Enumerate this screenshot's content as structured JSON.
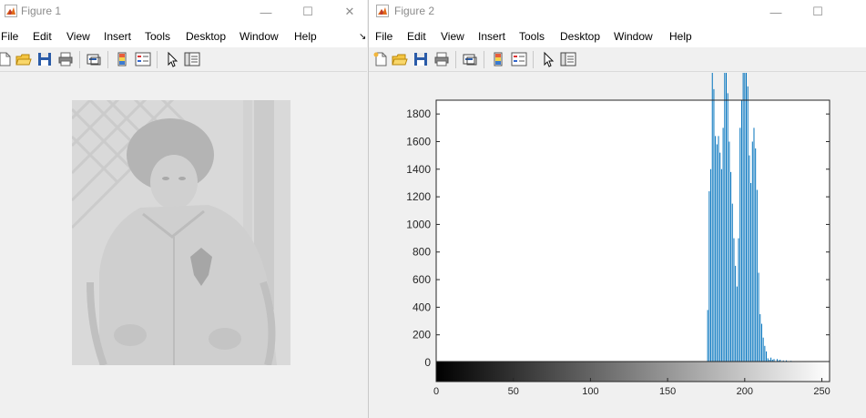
{
  "colors": {
    "bar": "#0072bd",
    "titlebar_bg": "#ffffff",
    "figure_bg": "#f0f0f0",
    "axes_bg": "#ffffff"
  },
  "figure1": {
    "title": "Figure 1",
    "menu": [
      "File",
      "Edit",
      "View",
      "Insert",
      "Tools",
      "Desktop",
      "Window",
      "Help"
    ],
    "image_description_icon": "photo-icon"
  },
  "figure2": {
    "title": "Figure 2",
    "menu": [
      "File",
      "Edit",
      "View",
      "Insert",
      "Tools",
      "Desktop",
      "Window",
      "Help"
    ]
  },
  "toolbar_icons": [
    "new-figure-icon",
    "open-file-icon",
    "save-icon",
    "print-icon",
    "link-plot-icon",
    "insert-colorbar-icon",
    "insert-legend-icon",
    "edit-plot-icon",
    "property-inspector-icon"
  ],
  "window_buttons": {
    "minimize": "—",
    "maximize": "☐",
    "close": "✕"
  },
  "chart_data": {
    "type": "bar",
    "title": "",
    "xlabel": "",
    "ylabel": "",
    "xlim": [
      0,
      255
    ],
    "ylim": [
      0,
      1900
    ],
    "grid": false,
    "legend": "none",
    "colorbar": "grayscale below x-axis",
    "xticks": [
      0,
      50,
      100,
      150,
      200,
      250
    ],
    "yticks": [
      0,
      200,
      400,
      600,
      800,
      1000,
      1200,
      1400,
      1600,
      1800
    ],
    "x": [
      176,
      177,
      178,
      179,
      180,
      181,
      182,
      183,
      184,
      185,
      186,
      187,
      188,
      189,
      190,
      191,
      192,
      193,
      194,
      195,
      196,
      197,
      198,
      199,
      200,
      201,
      202,
      203,
      204,
      205,
      206,
      207,
      208,
      209,
      210,
      211,
      212,
      213,
      214,
      215,
      216,
      217,
      218,
      219,
      220,
      221,
      222,
      223,
      224,
      225,
      226,
      227,
      228,
      229,
      230,
      231,
      232,
      233,
      234,
      235,
      236,
      237,
      238,
      239,
      240,
      241,
      242,
      243,
      244,
      245,
      246,
      247,
      248,
      249,
      250
    ],
    "values": [
      380,
      1240,
      1400,
      2200,
      1980,
      1640,
      1580,
      1640,
      1520,
      1400,
      1700,
      2200,
      2250,
      1950,
      1600,
      1380,
      1150,
      900,
      700,
      550,
      900,
      1700,
      1900,
      2200,
      2300,
      2100,
      2000,
      1500,
      1300,
      1600,
      1700,
      1550,
      1250,
      650,
      350,
      280,
      180,
      120,
      80,
      30,
      20,
      35,
      20,
      25,
      10,
      25,
      15,
      20,
      10,
      15,
      10,
      15,
      10,
      10,
      12,
      8,
      10,
      5,
      8,
      5,
      3,
      4,
      6,
      5,
      5,
      3,
      4,
      3,
      2,
      2,
      3,
      2,
      2,
      1,
      2
    ]
  }
}
